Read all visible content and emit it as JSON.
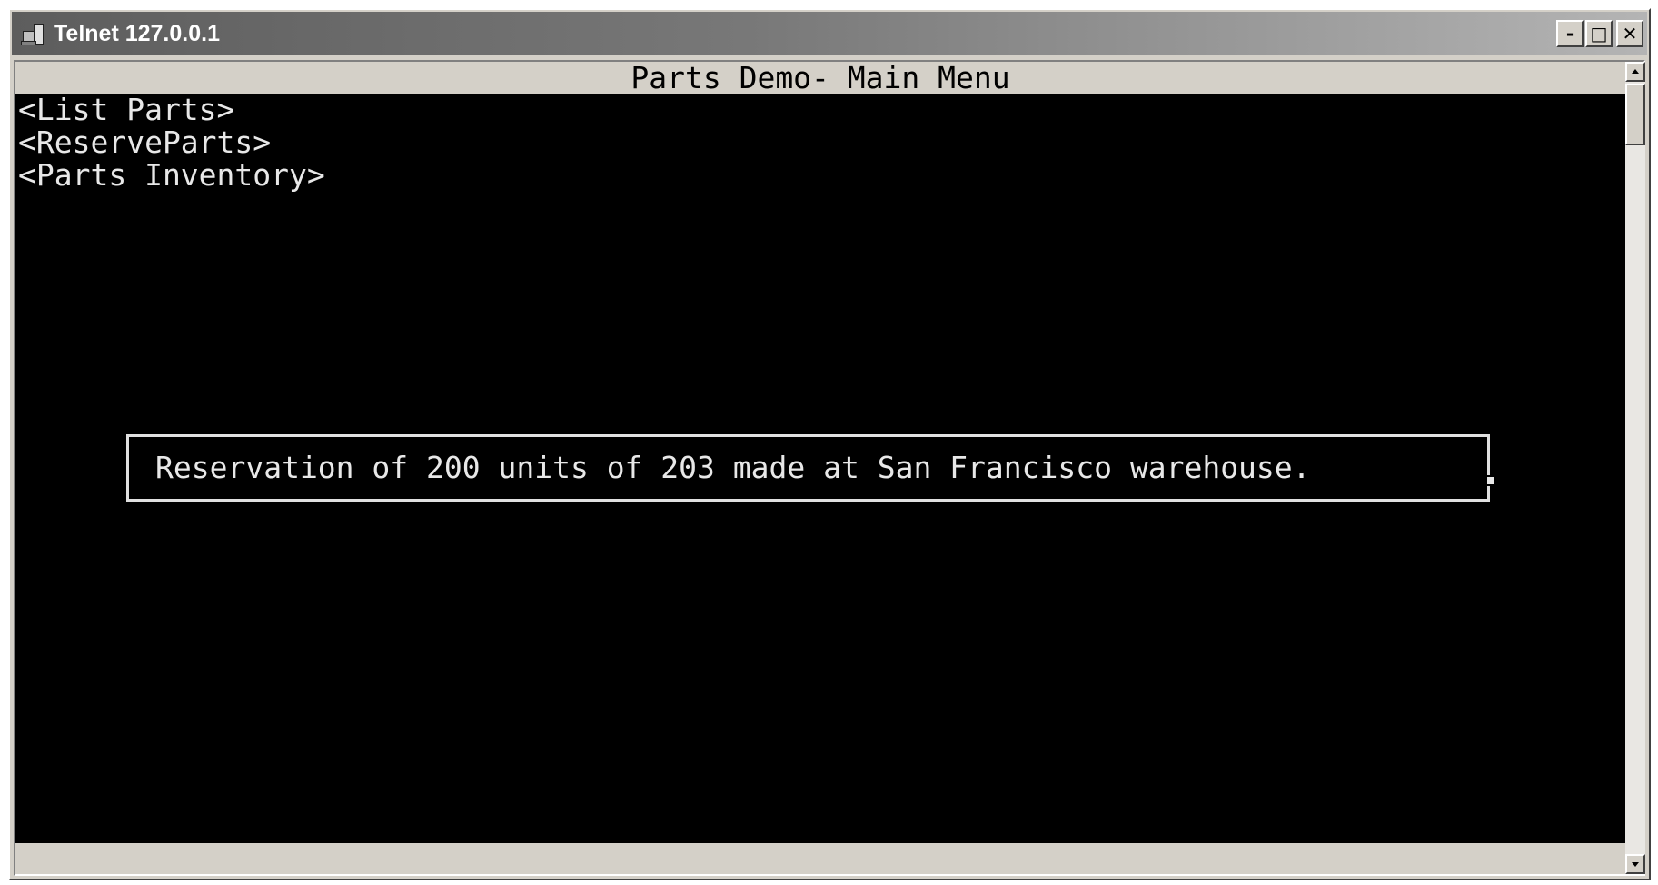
{
  "window": {
    "title": "Telnet 127.0.0.1",
    "icon": "computer-icon",
    "controls": {
      "minimize": "-",
      "maximize": "□",
      "close": "✕"
    }
  },
  "terminal": {
    "header": "Parts Demo- Main Menu",
    "menu_items": [
      "<List Parts>",
      "<ReserveParts>",
      "<Parts Inventory>"
    ],
    "message": "Reservation of 200 units of 203 made at San Francisco warehouse.",
    "colors": {
      "background": "#000000",
      "foreground": "#e8e8e8",
      "header_bar": "#d4d0c8"
    }
  }
}
